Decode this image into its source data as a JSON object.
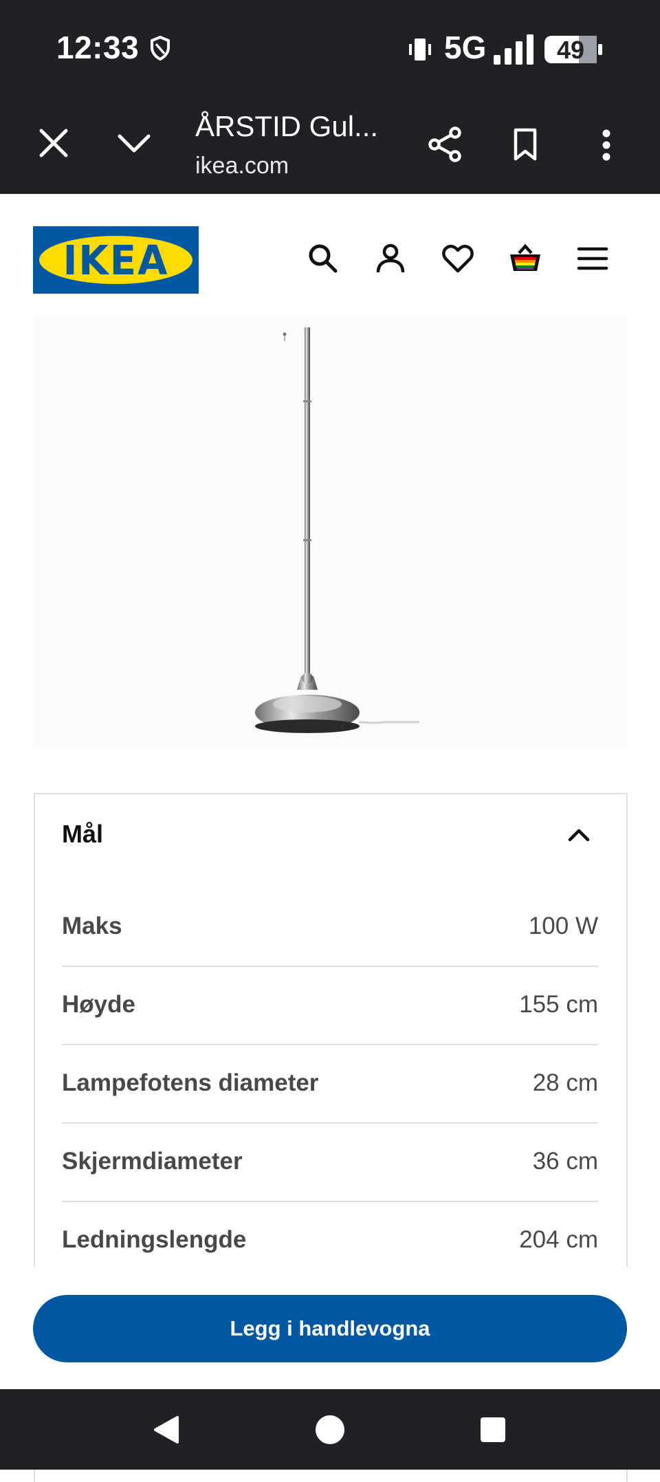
{
  "status_bar": {
    "time": "12:33",
    "network": "5G",
    "battery": "49",
    "icons": [
      "shield-icon",
      "vibrate-icon",
      "signal-icon",
      "battery-icon"
    ]
  },
  "browser": {
    "tab_title": "ÅRSTID Gul...",
    "url": "ikea.com",
    "icons": [
      "close-icon",
      "chevron-down-icon",
      "share-icon",
      "bookmark-icon",
      "more-vert-icon"
    ]
  },
  "site_header": {
    "logo_text": "IKEA",
    "brand_blue": "#0058a3",
    "brand_yellow": "#ffdb00",
    "icons": [
      "search-icon",
      "account-icon",
      "heart-icon",
      "basket-icon",
      "hamburger-menu-icon"
    ]
  },
  "dimensions_panel": {
    "title": "Mål",
    "expanded": true,
    "rows": [
      {
        "label": "Maks",
        "value": "100 W"
      },
      {
        "label": "Høyde",
        "value": "155 cm"
      },
      {
        "label": "Lampefotens diameter",
        "value": "28 cm"
      },
      {
        "label": "Skjermdiameter",
        "value": "36 cm"
      },
      {
        "label": "Ledningslengde",
        "value": "204 cm"
      }
    ]
  },
  "cta": {
    "label": "Legg i handlevogna"
  },
  "android_nav": {
    "icons": [
      "back-icon",
      "home-icon",
      "recents-icon"
    ]
  }
}
